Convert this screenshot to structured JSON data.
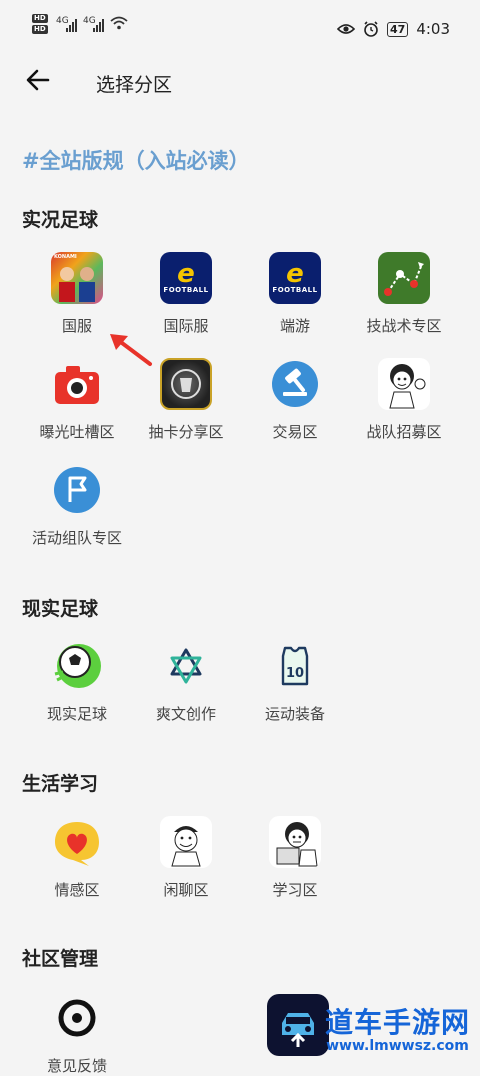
{
  "status": {
    "hd1": "HD",
    "hd2": "HD",
    "sig1": "4G",
    "sig2": "4G",
    "battery": "47",
    "time": "4:03"
  },
  "header": {
    "title": "选择分区"
  },
  "rules_link": "#全站版规（入站必读）",
  "sections": {
    "s1": {
      "title": "实况足球",
      "items": [
        "国服",
        "国际服",
        "端游",
        "技战术专区",
        "曝光吐槽区",
        "抽卡分享区",
        "交易区",
        "战队招募区",
        "活动组队专区"
      ]
    },
    "s2": {
      "title": "现实足球",
      "items": [
        "现实足球",
        "爽文创作",
        "运动装备"
      ]
    },
    "s3": {
      "title": "生活学习",
      "items": [
        "情感区",
        "闲聊区",
        "学习区"
      ]
    },
    "s4": {
      "title": "社区管理",
      "items": [
        "意见反馈"
      ]
    }
  },
  "icon_text": {
    "konami": "KONAMI",
    "e": "e",
    "football": "FOOTBALL",
    "jersey_number": "10"
  },
  "watermark": {
    "line1": "道车手游网",
    "line2": "www.lmwwsz.com"
  },
  "colors": {
    "rules": "#6a9fd0",
    "accent_red": "#e8332a",
    "efootball_bg": "#0a1f6e",
    "watermark": "#1565d8"
  }
}
